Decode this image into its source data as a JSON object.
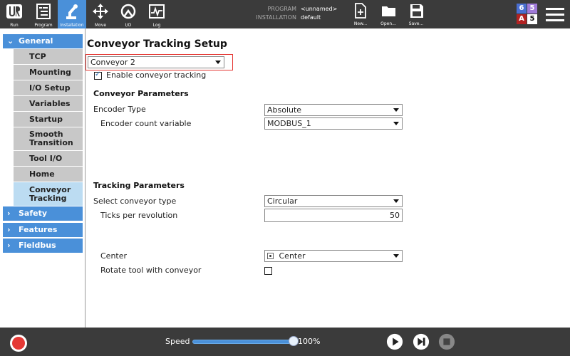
{
  "topbar": {
    "buttons": [
      {
        "label": "Run",
        "icon": "ur-logo-icon"
      },
      {
        "label": "Program",
        "icon": "program-icon"
      },
      {
        "label": "Installation",
        "icon": "robot-arm-icon"
      },
      {
        "label": "Move",
        "icon": "move-arrows-icon"
      },
      {
        "label": "I/O",
        "icon": "io-icon"
      },
      {
        "label": "Log",
        "icon": "log-icon"
      }
    ],
    "program_key": "PROGRAM",
    "program_value": "<unnamed>",
    "installation_key": "INSTALLATION",
    "installation_value": "default",
    "file_buttons": [
      {
        "label": "New...",
        "icon": "new-file-icon"
      },
      {
        "label": "Open...",
        "icon": "folder-icon"
      },
      {
        "label": "Save...",
        "icon": "save-icon"
      }
    ],
    "badges": {
      "tl": "6",
      "tr": "5",
      "bl": "A",
      "br": "5"
    },
    "colors": {
      "bar": "#3b3b3b",
      "active": "#4a90d9",
      "badge_blue": "#4a6fd1",
      "badge_purple": "#a07ad8",
      "badge_red": "#b22222"
    }
  },
  "sidebar": {
    "general": "General",
    "items": [
      "TCP",
      "Mounting",
      "I/O Setup",
      "Variables",
      "Startup",
      "Smooth Transition",
      "Tool I/O",
      "Home",
      "Conveyor Tracking"
    ],
    "active": "Conveyor Tracking",
    "groups": [
      "Safety",
      "Features",
      "Fieldbus"
    ]
  },
  "main": {
    "title": "Conveyor Tracking Setup",
    "conveyor_select": "Conveyor 2",
    "enable_label": "Enable conveyor tracking",
    "enable_checked": true,
    "conveyor_params": "Conveyor Parameters",
    "encoder_type_label": "Encoder Type",
    "encoder_type_value": "Absolute",
    "encoder_count_label": "Encoder count variable",
    "encoder_count_value": "MODBUS_1",
    "tracking_params": "Tracking Parameters",
    "conveyor_type_label": "Select conveyor type",
    "conveyor_type_value": "Circular",
    "ticks_label": "Ticks per revolution",
    "ticks_value": "50",
    "center_label": "Center",
    "center_value": "Center",
    "rotate_label": "Rotate tool with conveyor",
    "rotate_checked": false
  },
  "bottombar": {
    "speed_label": "Speed",
    "speed_value": "100%",
    "speed_fraction": 1.0
  }
}
